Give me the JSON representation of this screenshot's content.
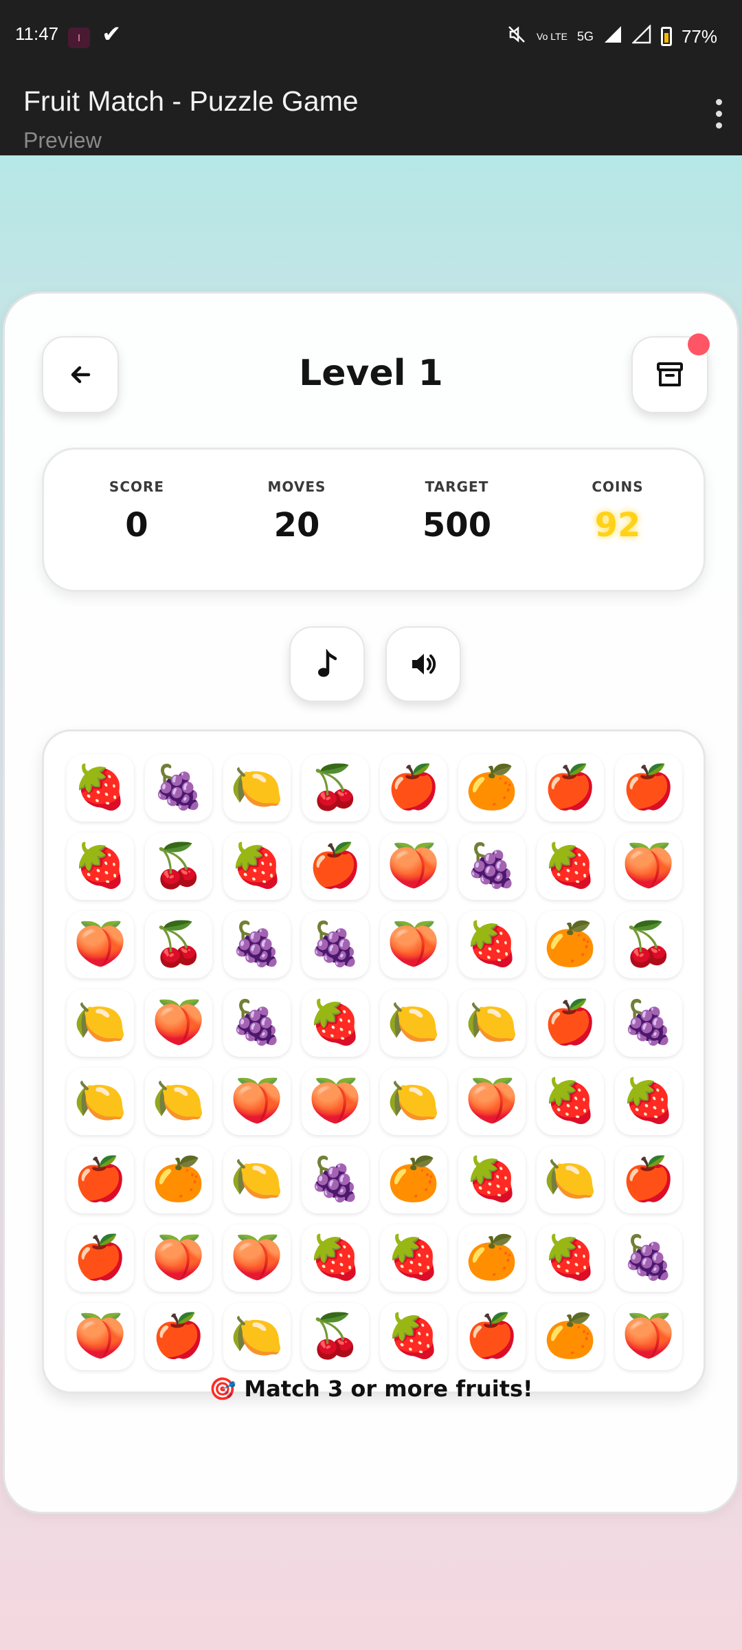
{
  "status_bar": {
    "time": "11:47",
    "battery": "77%",
    "volte": "Vo LTE",
    "network": "5G"
  },
  "app_bar": {
    "title": "Fruit Match - Puzzle Game",
    "subtitle": "Preview"
  },
  "game": {
    "level_title": "Level 1",
    "stats": [
      {
        "label": "SCORE",
        "value": "0"
      },
      {
        "label": "MOVES",
        "value": "20"
      },
      {
        "label": "TARGET",
        "value": "500"
      },
      {
        "label": "COINS",
        "value": "92"
      }
    ],
    "hint": "🎯 Match 3 or more fruits!",
    "colors": {
      "coins": "#ffd21a",
      "notification": "#ff5565"
    },
    "board": [
      [
        "🍓",
        "🍇",
        "🍋",
        "🍒",
        "🍎",
        "🍊",
        "🍎",
        "🍎"
      ],
      [
        "🍓",
        "🍒",
        "🍓",
        "🍎",
        "🍑",
        "🍇",
        "🍓",
        "🍑"
      ],
      [
        "🍑",
        "🍒",
        "🍇",
        "🍇",
        "🍑",
        "🍓",
        "🍊",
        "🍒"
      ],
      [
        "🍋",
        "🍑",
        "🍇",
        "🍓",
        "🍋",
        "🍋",
        "🍎",
        "🍇"
      ],
      [
        "🍋",
        "🍋",
        "🍑",
        "🍑",
        "🍋",
        "🍑",
        "🍓",
        "🍓"
      ],
      [
        "🍎",
        "🍊",
        "🍋",
        "🍇",
        "🍊",
        "🍓",
        "🍋",
        "🍎"
      ],
      [
        "🍎",
        "🍑",
        "🍑",
        "🍓",
        "🍓",
        "🍊",
        "🍓",
        "🍇"
      ],
      [
        "🍑",
        "🍎",
        "🍋",
        "🍒",
        "🍓",
        "🍎",
        "🍊",
        "🍑"
      ]
    ]
  },
  "icons": {
    "back": "arrow-left-icon",
    "archive": "archive-box-icon",
    "music": "music-note-icon",
    "sound": "speaker-icon",
    "menu": "more-vert-icon"
  }
}
